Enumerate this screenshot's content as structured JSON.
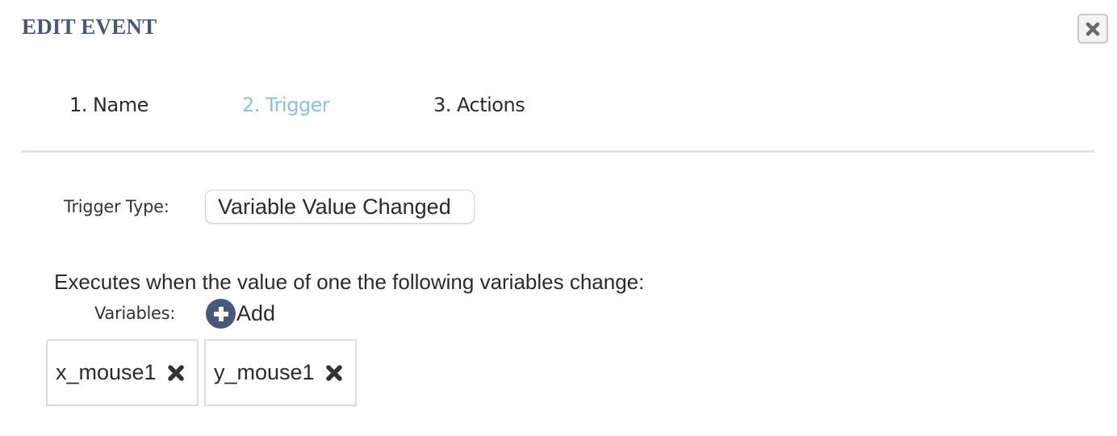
{
  "dialog": {
    "title": "EDIT EVENT",
    "close_icon": "close-icon"
  },
  "steps": [
    {
      "label": "1. Name",
      "active": false
    },
    {
      "label": "2. Trigger",
      "active": true
    },
    {
      "label": "3. Actions",
      "active": false
    }
  ],
  "trigger": {
    "label": "Trigger Type:",
    "selected": "Variable Value Changed"
  },
  "description": "Executes when the value of one the following variables change:",
  "variables": {
    "label": "Variables:",
    "add_label": "Add",
    "add_icon": "plus-circle-icon",
    "items": [
      {
        "name": "x_mouse1",
        "remove_icon": "remove-icon"
      },
      {
        "name": "y_mouse1",
        "remove_icon": "remove-icon"
      }
    ]
  },
  "colors": {
    "title": "#475878",
    "active_step": "#8ec3d6",
    "add_icon_bg": "#475878"
  }
}
